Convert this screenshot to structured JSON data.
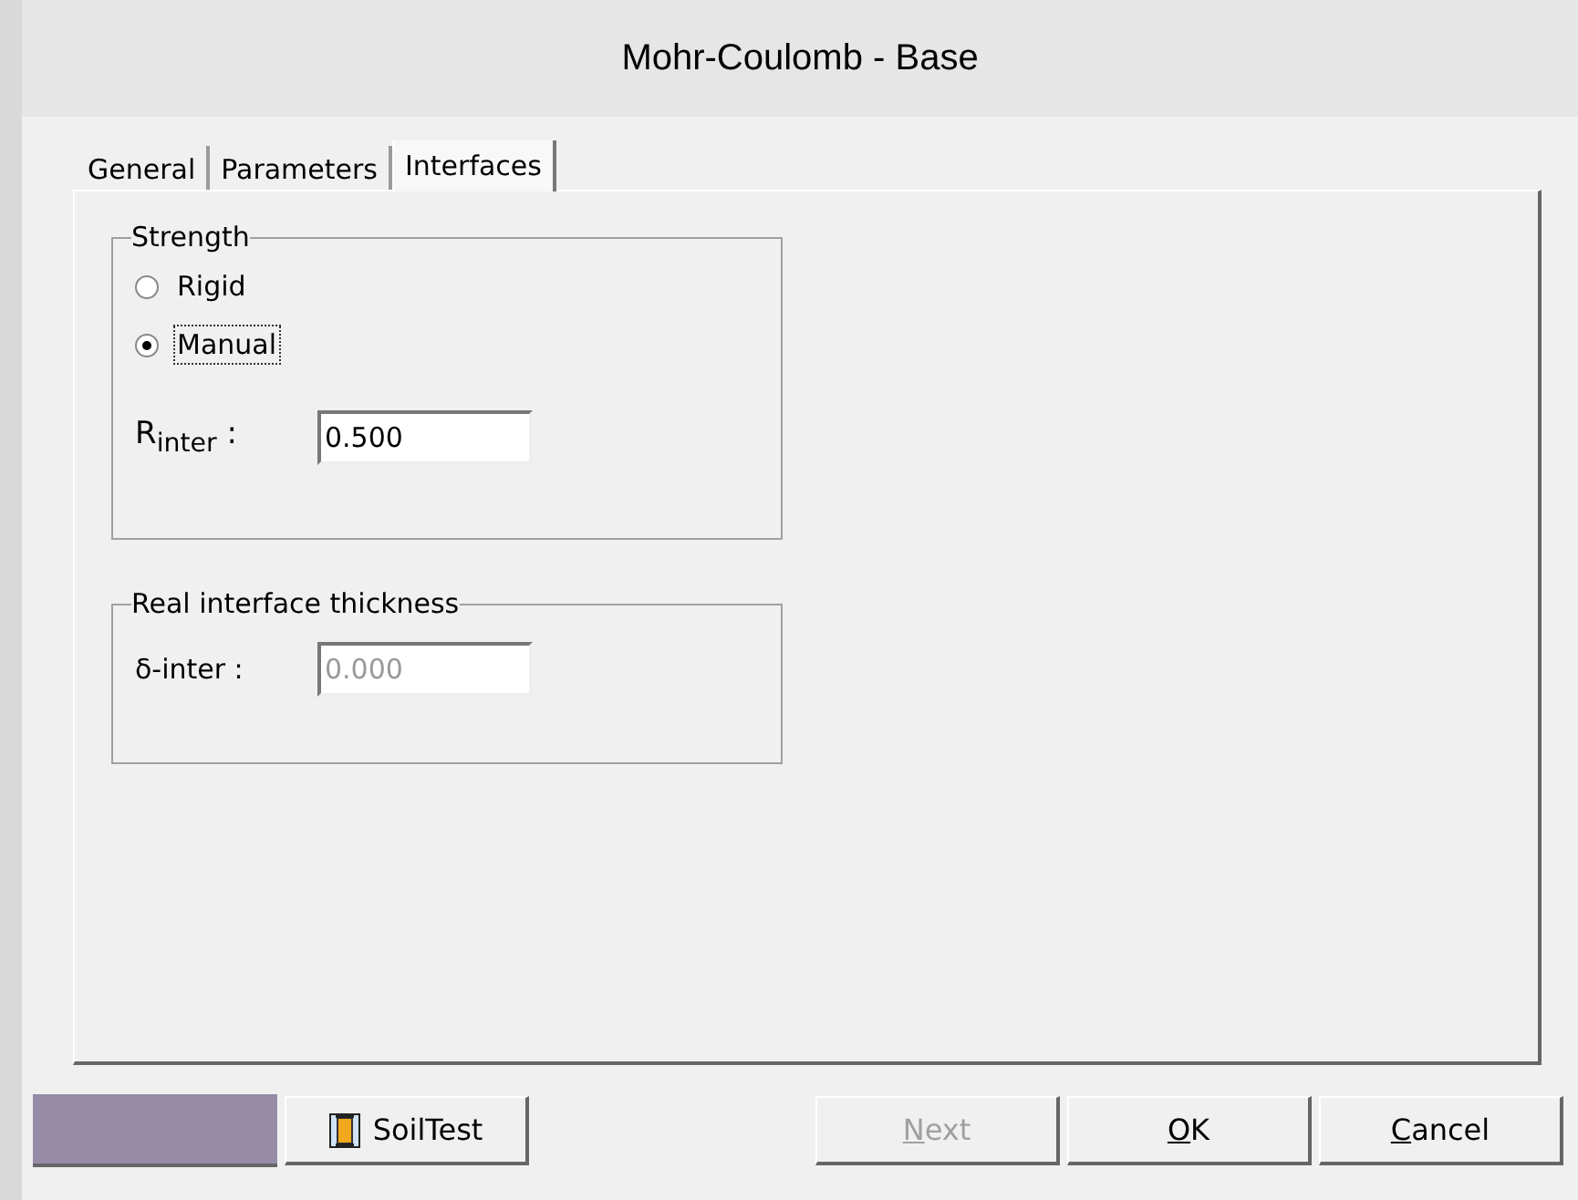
{
  "window": {
    "title": "Mohr-Coulomb - Base"
  },
  "tabs": [
    {
      "label": "General",
      "selected": false
    },
    {
      "label": "Parameters",
      "selected": false
    },
    {
      "label": "Interfaces",
      "selected": true
    }
  ],
  "strength": {
    "title": "Strength",
    "options": [
      {
        "label": "Rigid",
        "selected": false,
        "focused": false
      },
      {
        "label": "Manual",
        "selected": true,
        "focused": true
      }
    ],
    "field": {
      "label": "R$_{inter}$ :",
      "value": "0.500",
      "disabled": false
    }
  },
  "thickness": {
    "title": "Real interface thickness",
    "field": {
      "label": "δ-inter :",
      "value": "0.000",
      "disabled": true
    }
  },
  "swatch": {
    "color": "#968ca8"
  },
  "soiltest": {
    "label": "SoilTest"
  },
  "buttons": [
    {
      "access_key": "N",
      "label_rest": "ext",
      "disabled": true
    },
    {
      "access_key": "O",
      "label_rest": "K",
      "disabled": false
    },
    {
      "access_key": "C",
      "label_rest": "ancel",
      "disabled": false
    }
  ]
}
